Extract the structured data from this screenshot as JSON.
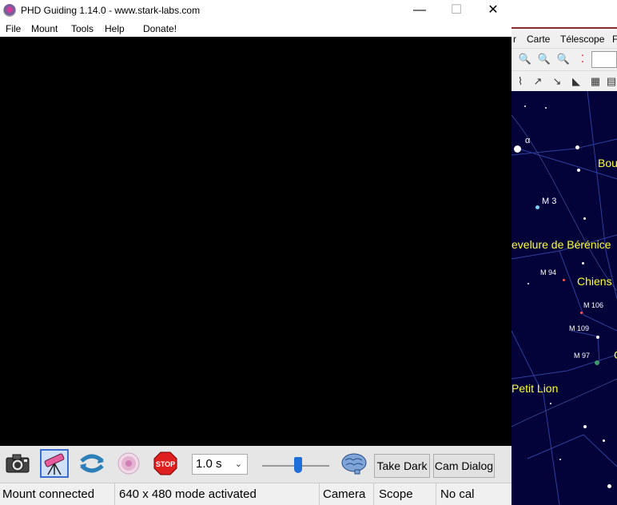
{
  "phd": {
    "title": "PHD Guiding 1.14.0  -  www.stark-labs.com",
    "window_controls": {
      "minimize": "—",
      "maximize": "☐",
      "close": "✕"
    },
    "menu": [
      "File",
      "Mount",
      "Tools",
      "Help",
      "Donate!"
    ],
    "toolbar": {
      "exposure": "1.0 s",
      "exposure_chevron": "⌄",
      "take_dark": "Take Dark",
      "cam_dialog": "Cam Dialog"
    },
    "status": {
      "mount": "Mount connected",
      "mode": "640 x 480 mode activated",
      "camera": "Camera",
      "scope": "Scope",
      "cal": "No cal"
    }
  },
  "background_app": {
    "menu": [
      "r",
      "Carte",
      "Télescope",
      "F"
    ],
    "labels": {
      "bouvier": "Bou",
      "m3": "M 3",
      "berenice": "evelure de Bérénice",
      "chiens": "Chiens",
      "m94": "M 94",
      "m106": "M 106",
      "m109": "M 109",
      "m97": "M 97",
      "petit_lion": "Petit Lion",
      "alpha": "α",
      "edge_c": "C"
    }
  },
  "colors": {
    "accent": "#1e6fd9",
    "sky": "#03033a",
    "constellation_label": "#ffff33",
    "viewport": "#000000"
  }
}
